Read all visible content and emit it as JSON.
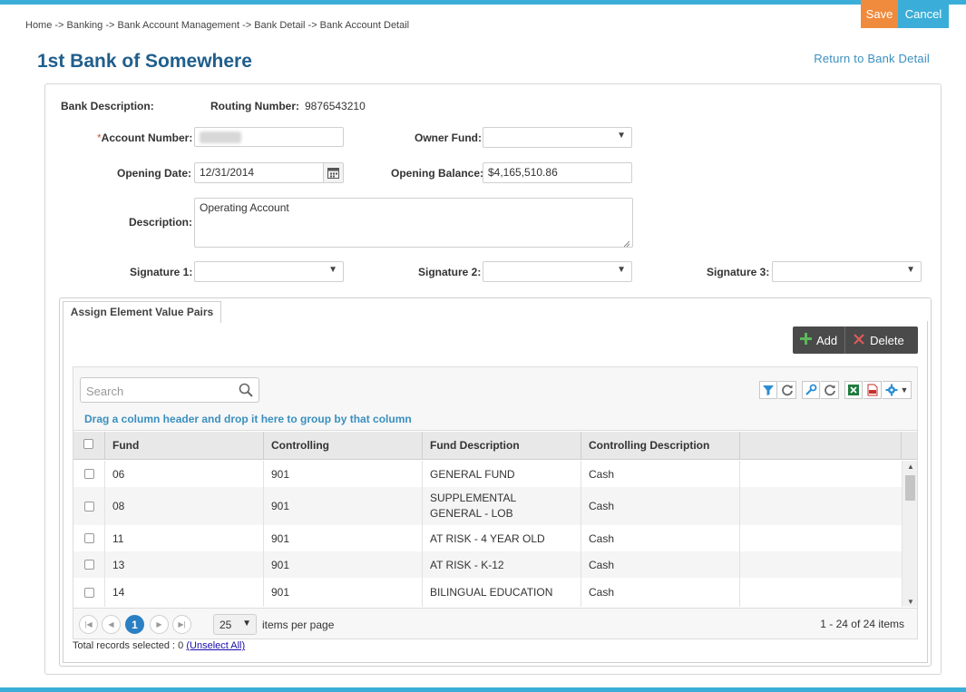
{
  "header": {
    "breadcrumb": "Home -> Banking -> Bank Account Management -> Bank Detail -> Bank Account Detail",
    "save_label": "Save",
    "cancel_label": "Cancel",
    "title": "1st Bank of Somewhere",
    "return_link": "Return to Bank Detail"
  },
  "form": {
    "bank_description_label": "Bank Description:",
    "routing_number_label": "Routing Number:",
    "routing_number_value": "9876543210",
    "account_number_required": "*",
    "account_number_label": "Account Number:",
    "owner_fund_label": "Owner Fund:",
    "owner_fund_value": "",
    "opening_date_label": "Opening Date:",
    "opening_date_value": "12/31/2014",
    "opening_balance_label": "Opening Balance:",
    "opening_balance_value": "$4,165,510.86",
    "description_label": "Description:",
    "description_value": "Operating Account",
    "signature1_label": "Signature 1:",
    "signature2_label": "Signature 2:",
    "signature3_label": "Signature 3:"
  },
  "tab": {
    "label": "Assign Element Value Pairs",
    "add_label": "Add",
    "delete_label": "Delete"
  },
  "grid": {
    "search_placeholder": "Search",
    "group_hint": "Drag a column header and drop it here to group by that column",
    "columns": [
      "Fund",
      "Controlling",
      "Fund Description",
      "Controlling Description"
    ],
    "rows": [
      {
        "fund": "06",
        "controlling": "901",
        "fund_description": "GENERAL FUND",
        "controlling_description": "Cash"
      },
      {
        "fund": "08",
        "controlling": "901",
        "fund_description": "SUPPLEMENTAL GENERAL - LOB",
        "controlling_description": "Cash"
      },
      {
        "fund": "11",
        "controlling": "901",
        "fund_description": "AT RISK - 4 YEAR OLD",
        "controlling_description": "Cash"
      },
      {
        "fund": "13",
        "controlling": "901",
        "fund_description": "AT RISK - K-12",
        "controlling_description": "Cash"
      },
      {
        "fund": "14",
        "controlling": "901",
        "fund_description": "BILINGUAL EDUCATION",
        "controlling_description": "Cash"
      }
    ],
    "current_page": "1",
    "page_size": "25",
    "per_page_label": "items per page",
    "page_info": "1 - 24 of 24 items"
  },
  "footer": {
    "records_label": "Total records selected : 0",
    "unselect_label": "(Unselect All)"
  },
  "colors": {
    "accent": "#3aaed8",
    "save": "#f08a3c",
    "title": "#1f5e8c",
    "pager_active": "#2b7fc3"
  },
  "icons": [
    "calendar-icon",
    "plus-icon",
    "delete-x-icon",
    "search-icon",
    "filter-icon",
    "refresh-icon",
    "wrench-icon",
    "excel-icon",
    "pdf-icon",
    "gear-icon"
  ]
}
